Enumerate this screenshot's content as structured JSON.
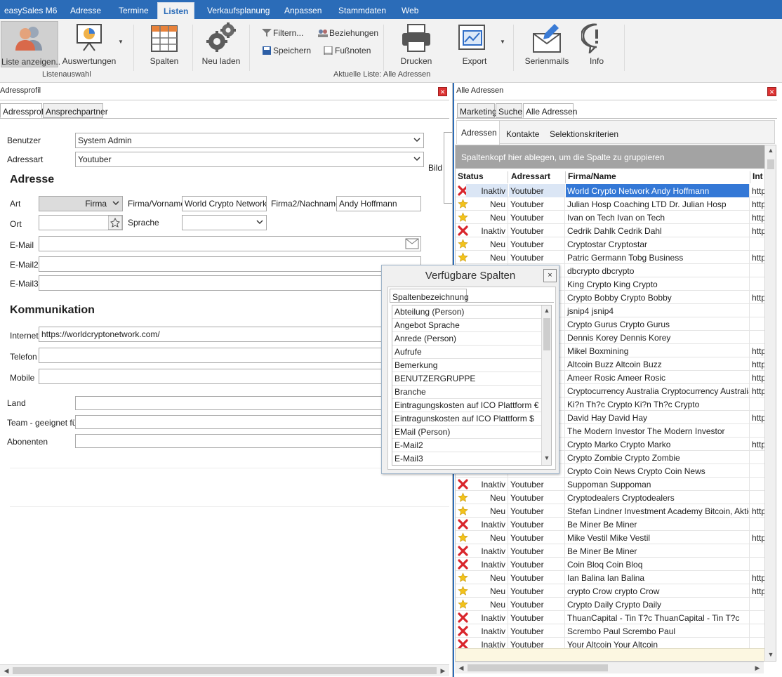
{
  "app": {
    "title": "easySales M6"
  },
  "menu": {
    "tabs": [
      "Adresse",
      "Termine",
      "Listen",
      "Verkaufsplanung",
      "Anpassen",
      "Stammdaten",
      "Web"
    ],
    "active": "Listen"
  },
  "ribbon": {
    "liste_anzeigen": "Liste anzeigen..",
    "auswertungen": "Auswertungen",
    "group_listenauswahl": "Listenauswahl",
    "spalten": "Spalten",
    "neu_laden": "Neu laden",
    "filtern": "Filtern...",
    "speichern": "Speichern",
    "beziehungen": "Beziehungen",
    "fussnoten": "Fußnoten",
    "drucken": "Drucken",
    "export": "Export",
    "group_aktuelle": "Aktuelle Liste: Alle Adressen",
    "serienmails": "Serienmails",
    "info": "Info"
  },
  "left": {
    "title": "Adressprofil",
    "tabs": [
      "Adressprofil",
      "Ansprechpartner"
    ],
    "benutzer_label": "Benutzer",
    "benutzer_value": "System Admin",
    "adressart_label": "Adressart",
    "adressart_value": "Youtuber",
    "bild_label": "Bild",
    "adresse_heading": "Adresse",
    "art_label": "Art",
    "art_value": "Firma",
    "firma_vorname_label": "Firma/Vorname",
    "firma_vorname_value": "World Crypto Network",
    "firma2_label": "Firma2/Nachname",
    "firma2_value": "Andy Hoffmann",
    "ort_label": "Ort",
    "sprache_label": "Sprache",
    "email_label": "E-Mail",
    "email2_label": "E-Mail2",
    "email3_label": "E-Mail3",
    "kommunikation_heading": "Kommunikation",
    "internet_label": "Internet",
    "internet_value": "https://worldcryptonetwork.com/",
    "telefon_label": "Telefon",
    "mobile_label": "Mobile",
    "land_label": "Land",
    "team_label": "Team - geeignet für",
    "abonenten_label": "Abonenten"
  },
  "right": {
    "title": "Alle Adressen",
    "tabs": [
      "Marketing",
      "Suche",
      "Alle Adressen"
    ],
    "subtabs": [
      "Adressen",
      "Kontakte",
      "Selektionskriterien"
    ],
    "group_bar": "Spaltenkopf hier ablegen, um die Spalte zu gruppieren",
    "columns": [
      "Status",
      "Adressart",
      "Firma/Name",
      "Int"
    ],
    "rows": [
      {
        "status": "Inaktiv",
        "art": "Youtuber",
        "firma": "World Crypto Network Andy Hoffmann",
        "int": "http"
      },
      {
        "status": "Neu",
        "art": "Youtuber",
        "firma": "Julian Hosp Coaching LTD Dr. Julian Hosp",
        "int": "http"
      },
      {
        "status": "Neu",
        "art": "Youtuber",
        "firma": "Ivan on Tech Ivan on Tech",
        "int": "http"
      },
      {
        "status": "Inaktiv",
        "art": "Youtuber",
        "firma": "Cedrik Dahlk Cedrik Dahl",
        "int": "http"
      },
      {
        "status": "Neu",
        "art": "Youtuber",
        "firma": "Cryptostar Cryptostar",
        "int": ""
      },
      {
        "status": "Neu",
        "art": "Youtuber",
        "firma": "Patric Germann Tobg Business",
        "int": "http"
      },
      {
        "status": "",
        "art": "",
        "firma": "dbcrypto dbcrypto",
        "int": ""
      },
      {
        "status": "",
        "art": "",
        "firma": "King Crypto King Crypto",
        "int": ""
      },
      {
        "status": "",
        "art": "",
        "firma": "Crypto Bobby Crypto Bobby",
        "int": "http"
      },
      {
        "status": "",
        "art": "",
        "firma": "jsnip4 jsnip4",
        "int": ""
      },
      {
        "status": "",
        "art": "",
        "firma": "Crypto Gurus Crypto Gurus",
        "int": ""
      },
      {
        "status": "",
        "art": "",
        "firma": "Dennis Korey Dennis Korey",
        "int": ""
      },
      {
        "status": "",
        "art": "",
        "firma": "Mikel Boxmining",
        "int": "http"
      },
      {
        "status": "",
        "art": "",
        "firma": "Altcoin Buzz Altcoin Buzz",
        "int": "http"
      },
      {
        "status": "",
        "art": "",
        "firma": "Ameer Rosic Ameer Rosic",
        "int": "http"
      },
      {
        "status": "",
        "art": "",
        "firma": "Cryptocurrency Australia Cryptocurrency Australia",
        "int": "http"
      },
      {
        "status": "",
        "art": "",
        "firma": "Ki?n Th?c Crypto Ki?n Th?c Crypto",
        "int": ""
      },
      {
        "status": "",
        "art": "",
        "firma": "David Hay David Hay",
        "int": "http"
      },
      {
        "status": "",
        "art": "",
        "firma": "The Modern Investor The Modern Investor",
        "int": ""
      },
      {
        "status": "",
        "art": "",
        "firma": "Crypto Marko Crypto Marko",
        "int": "http"
      },
      {
        "status": "",
        "art": "",
        "firma": "Crypto Zombie Crypto Zombie",
        "int": ""
      },
      {
        "status": "",
        "art": "",
        "firma": "Crypto Coin News Crypto Coin News",
        "int": ""
      },
      {
        "status": "Inaktiv",
        "art": "Youtuber",
        "firma": "Suppoman Suppoman",
        "int": ""
      },
      {
        "status": "Neu",
        "art": "Youtuber",
        "firma": "Cryptodealers Cryptodealers",
        "int": ""
      },
      {
        "status": "Neu",
        "art": "Youtuber",
        "firma": "Stefan Lindner Investment Academy Bitcoin, Aktien un",
        "int": "http"
      },
      {
        "status": "Inaktiv",
        "art": "Youtuber",
        "firma": "Be Miner Be Miner",
        "int": ""
      },
      {
        "status": "Neu",
        "art": "Youtuber",
        "firma": "Mike Vestil Mike Vestil",
        "int": "http"
      },
      {
        "status": "Inaktiv",
        "art": "Youtuber",
        "firma": "Be Miner Be Miner",
        "int": ""
      },
      {
        "status": "Inaktiv",
        "art": "Youtuber",
        "firma": "Coin Bloq Coin Bloq",
        "int": ""
      },
      {
        "status": "Neu",
        "art": "Youtuber",
        "firma": "Ian Balina Ian Balina",
        "int": "http"
      },
      {
        "status": "Neu",
        "art": "Youtuber",
        "firma": "crypto Crow crypto Crow",
        "int": "http"
      },
      {
        "status": "Neu",
        "art": "Youtuber",
        "firma": "Crypto Daily Crypto Daily",
        "int": ""
      },
      {
        "status": "Inaktiv",
        "art": "Youtuber",
        "firma": "ThuanCapital - Tin T?c ThuanCapital - Tin T?c",
        "int": ""
      },
      {
        "status": "Inaktiv",
        "art": "Youtuber",
        "firma": "Scrembo Paul Scrembo Paul",
        "int": ""
      },
      {
        "status": "Inaktiv",
        "art": "Youtuber",
        "firma": "Your Altcoin Your Altcoin",
        "int": ""
      }
    ]
  },
  "dialog": {
    "title": "Verfügbare Spalten",
    "close": "×",
    "tab": "Spaltenbezeichnung",
    "items": [
      "Abteilung (Person)",
      "Angebot Sprache",
      "Anrede (Person)",
      "Aufrufe",
      "Bemerkung",
      "BENUTZERGRUPPE",
      "Branche",
      "Eintragungskosten auf ICO Plattform €",
      "Eintragunskosten auf ICO Plattform $",
      "EMail (Person)",
      "E-Mail2",
      "E-Mail3"
    ]
  },
  "colors": {
    "brand": "#2b6cb8",
    "selection": "#3478d6",
    "inactive": "#d9262c",
    "new": "#f2c21b"
  }
}
